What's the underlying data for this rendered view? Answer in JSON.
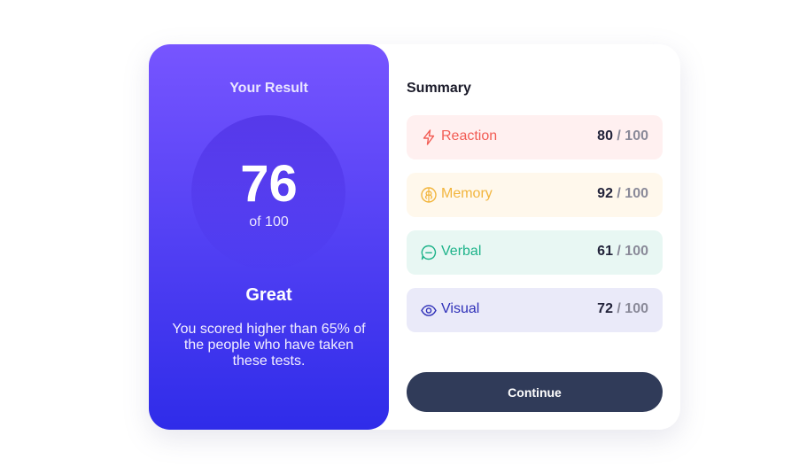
{
  "result": {
    "title": "Your Result",
    "score": "76",
    "score_max": "of 100",
    "rating": "Great",
    "message": "You scored higher than 65% of the people who have taken these tests."
  },
  "summary": {
    "title": "Summary",
    "items": [
      {
        "label": "Reaction",
        "value": "80",
        "max": " / 100",
        "icon": "lightning-icon",
        "color": "#f25c54",
        "bg": "#fff0f0"
      },
      {
        "label": "Memory",
        "value": "92",
        "max": " / 100",
        "icon": "brain-icon",
        "color": "#f2b53d",
        "bg": "#fff8ec"
      },
      {
        "label": "Verbal",
        "value": "61",
        "max": " / 100",
        "icon": "chat-bubble-icon",
        "color": "#1eb38a",
        "bg": "#e8f7f3"
      },
      {
        "label": "Visual",
        "value": "72",
        "max": " / 100",
        "icon": "eye-icon",
        "color": "#2e2fb8",
        "bg": "#eaeaf9"
      }
    ]
  },
  "continue_label": "Continue",
  "colors": {
    "gradient_top": "#7755ff",
    "gradient_bottom": "#2f2ce9",
    "button": "#303b59"
  }
}
